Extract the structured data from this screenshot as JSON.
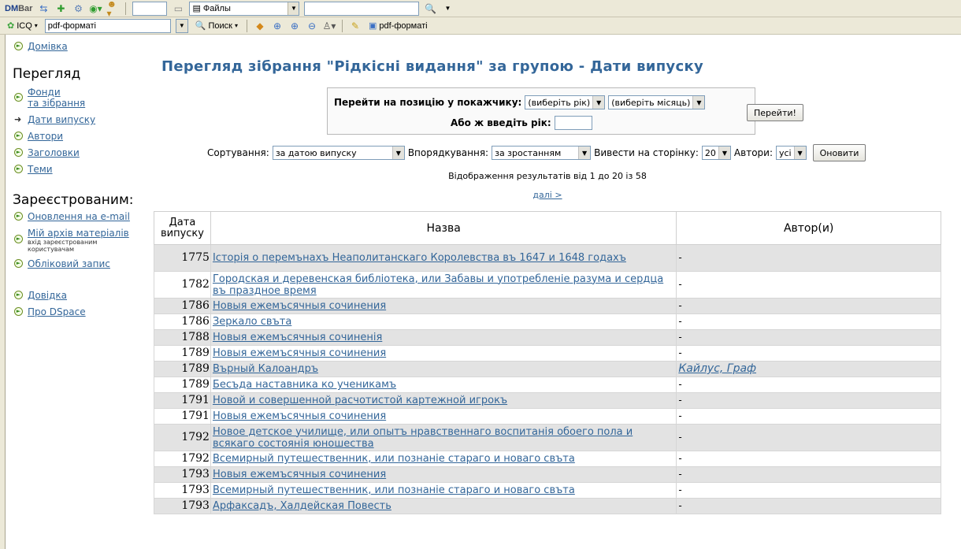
{
  "toolbar1": {
    "brand_dm": "DM",
    "brand_bar": "Bar",
    "address": "Файлы",
    "search_value": ""
  },
  "toolbar2": {
    "icq": "ICQ",
    "search_text": "pdf-форматі",
    "search_btn": "Поиск",
    "result_text": "pdf-форматі"
  },
  "sidebar": {
    "home": "Домівка",
    "browse_heading": "Перегляд",
    "browse_items": [
      {
        "label": "Фонди",
        "label2": "та зібрання"
      },
      {
        "label": "Дати випуску"
      },
      {
        "label": "Автори"
      },
      {
        "label": "Заголовки"
      },
      {
        "label": "Теми"
      }
    ],
    "registered_heading": "Зареєстрованим:",
    "registered_items": [
      {
        "label": "Оновлення на e-mail"
      },
      {
        "label": "Мій архів матеріалів",
        "sub": "вхід зареєстрованим користувачам"
      },
      {
        "label": "Обліковий запис"
      }
    ],
    "help": "Довідка",
    "about": "Про DSpace"
  },
  "main": {
    "title": "Перегляд зібрання \"Рідкісні видання\" за групою - Дати випуску",
    "jump": {
      "label": "Перейти на позицію у покажчику:",
      "year_select": "(виберіть рік)",
      "month_select": "(виберіть місяць)",
      "or_label": "Або ж введіть рік:",
      "button": "Перейти!"
    },
    "controls": {
      "sort_label": "Сортування:",
      "sort_value": "за датою випуску",
      "order_label": "Впорядкування:",
      "order_value": "за зростанням",
      "perpage_label": "Вивести на сторінку:",
      "perpage_value": "20",
      "authors_label": "Автори:",
      "authors_value": "усі",
      "update_button": "Оновити"
    },
    "results_text": "Відображення результатів від 1 до 20 із 58",
    "next_text": "далі >"
  },
  "table": {
    "headers": [
      "Дата випуску",
      "Назва",
      "Автор(и)"
    ],
    "rows": [
      {
        "year": "1775",
        "title": "Історія о перемънахъ Неаполитанскаго Королевства въ 1647 и 1648 годахъ",
        "author": "-"
      },
      {
        "year": "1782",
        "title": "Городская и деревенская библіотека, или Забавы и употребленіе разума и сердца въ праздное время",
        "author": "-"
      },
      {
        "year": "1786",
        "title": "Новыя ежемъсячныя сочинения",
        "author": "-"
      },
      {
        "year": "1786",
        "title": "Зеркало свъта",
        "author": "-"
      },
      {
        "year": "1788",
        "title": "Новыя ежемъсячныя сочиненія",
        "author": "-"
      },
      {
        "year": "1789",
        "title": "Новыя ежемъсячныя сочинения",
        "author": "-"
      },
      {
        "year": "1789",
        "title": "Върный Калоандръ",
        "author": "Кайлус, Граф"
      },
      {
        "year": "1789",
        "title": "Бесъда наставника ко ученикамъ",
        "author": "-"
      },
      {
        "year": "1791",
        "title": "Новой и совершенной расчотистой картежной игрокъ",
        "author": "-"
      },
      {
        "year": "1791",
        "title": "Новыя ежемъсячныя сочинения",
        "author": "-"
      },
      {
        "year": "1792",
        "title": "Новое детское училище, или опытъ нравственнаго воспитанія обоего пола и всякаго состоянія юношества",
        "author": "-"
      },
      {
        "year": "1792",
        "title": "Всемирный путешественник, или познаніе стараго и новаго свъта",
        "author": "-"
      },
      {
        "year": "1793",
        "title": "Новыя ежемъсячныя сочинения",
        "author": "-"
      },
      {
        "year": "1793",
        "title": "Всемирный путешественник, или познаніе стараго и новаго свъта",
        "author": "-"
      },
      {
        "year": "1793",
        "title": "Арфаксадъ, Халдейская Повесть",
        "author": "-"
      }
    ]
  },
  "colors": {
    "link": "#336699",
    "title": "#336699",
    "row_alt": "#e3e3e3",
    "toolbar": "#ece9d8"
  }
}
